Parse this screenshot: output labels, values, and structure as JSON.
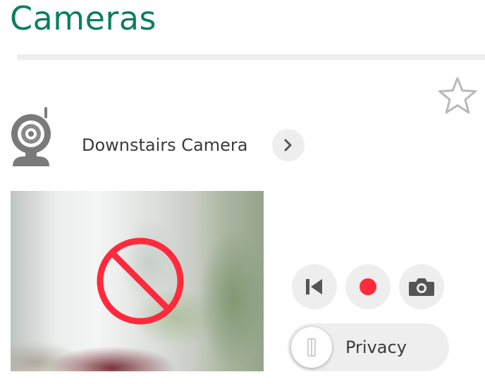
{
  "page": {
    "title": "Cameras"
  },
  "camera": {
    "name": "Downstairs Camera",
    "preview_status": "blocked"
  },
  "controls": {
    "previous_icon": "skip-back-icon",
    "record_icon": "record-icon",
    "snapshot_icon": "camera-snapshot-icon"
  },
  "privacy": {
    "label": "Privacy",
    "enabled": false
  },
  "colors": {
    "title": "#0b7f5f",
    "record": "#ff2a3c",
    "blocked": "#ff2a3c",
    "button_bg": "#eeeeee"
  }
}
